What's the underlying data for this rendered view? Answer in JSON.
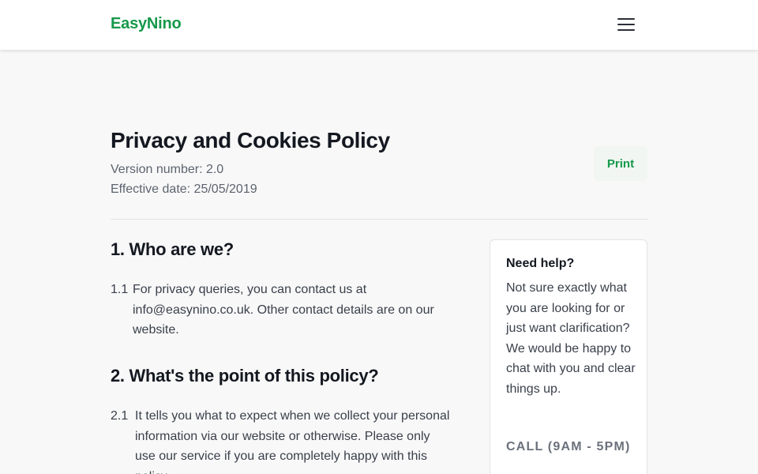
{
  "header": {
    "logo": "EasyNino",
    "menu_icon": "hamburger-menu-icon"
  },
  "policy": {
    "title": "Privacy and Cookies Policy",
    "version": "Version number: 2.0",
    "effective_date": "Effective date: 25/05/2019",
    "print_label": "Print"
  },
  "sections": [
    {
      "heading": "1. Who are we?",
      "clauses": [
        {
          "number": "1.1",
          "text": "For privacy queries, you can contact us at info@easynino.co.uk. Other contact details are on our website."
        }
      ]
    },
    {
      "heading": "2. What's the point of this policy?",
      "clauses": [
        {
          "number": "2.1",
          "text": "It tells you what to expect when we collect your personal information via our website or otherwise. Please only use our service if you are completely happy with this policy."
        }
      ]
    }
  ],
  "help": {
    "title": "Need help?",
    "body": "Not sure exactly what you are looking for or just want clarification? We would be happy to chat with you and clear things up.",
    "call": "CALL (9AM - 5PM)"
  },
  "colors": {
    "brand": "#15994a",
    "background": "#f8f8f8",
    "text": "#141820"
  }
}
